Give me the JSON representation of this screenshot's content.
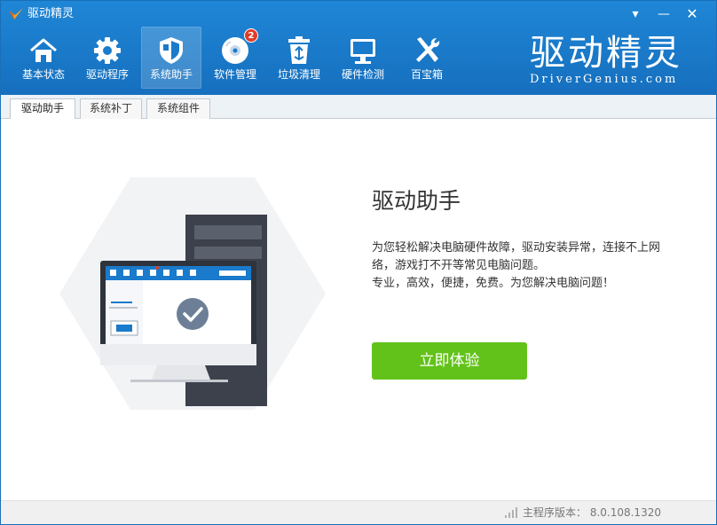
{
  "window": {
    "title": "驱动精灵",
    "controls": {
      "menu": "▾",
      "minimize": "—",
      "close": "✕"
    }
  },
  "nav": {
    "items": [
      {
        "label": "基本状态",
        "icon": "home-icon"
      },
      {
        "label": "驱动程序",
        "icon": "gear-icon"
      },
      {
        "label": "系统助手",
        "icon": "shield-icon",
        "active": true
      },
      {
        "label": "软件管理",
        "icon": "disc-icon",
        "badge": "2"
      },
      {
        "label": "垃圾清理",
        "icon": "recycle-bin-icon"
      },
      {
        "label": "硬件检测",
        "icon": "monitor-icon"
      },
      {
        "label": "百宝箱",
        "icon": "tools-icon"
      }
    ]
  },
  "brand": {
    "cn": "驱动精灵",
    "en": "DriverGenius.com"
  },
  "tabs": [
    {
      "label": "驱动助手",
      "active": true
    },
    {
      "label": "系统补丁"
    },
    {
      "label": "系统组件"
    }
  ],
  "main": {
    "title": "驱动助手",
    "description_line1": "为您轻松解决电脑硬件故障，驱动安装异常，连接不上网络，游戏打不开等常见电脑问题。",
    "description_line2": "专业，高效，便捷，免费。为您解决电脑问题！",
    "button_label": "立即体验"
  },
  "status": {
    "version_label": "主程序版本： 8.0.108.1320"
  },
  "colors": {
    "header_blue": "#1a7acb",
    "accent_green": "#62c21a",
    "badge_red": "#e23b2a"
  }
}
